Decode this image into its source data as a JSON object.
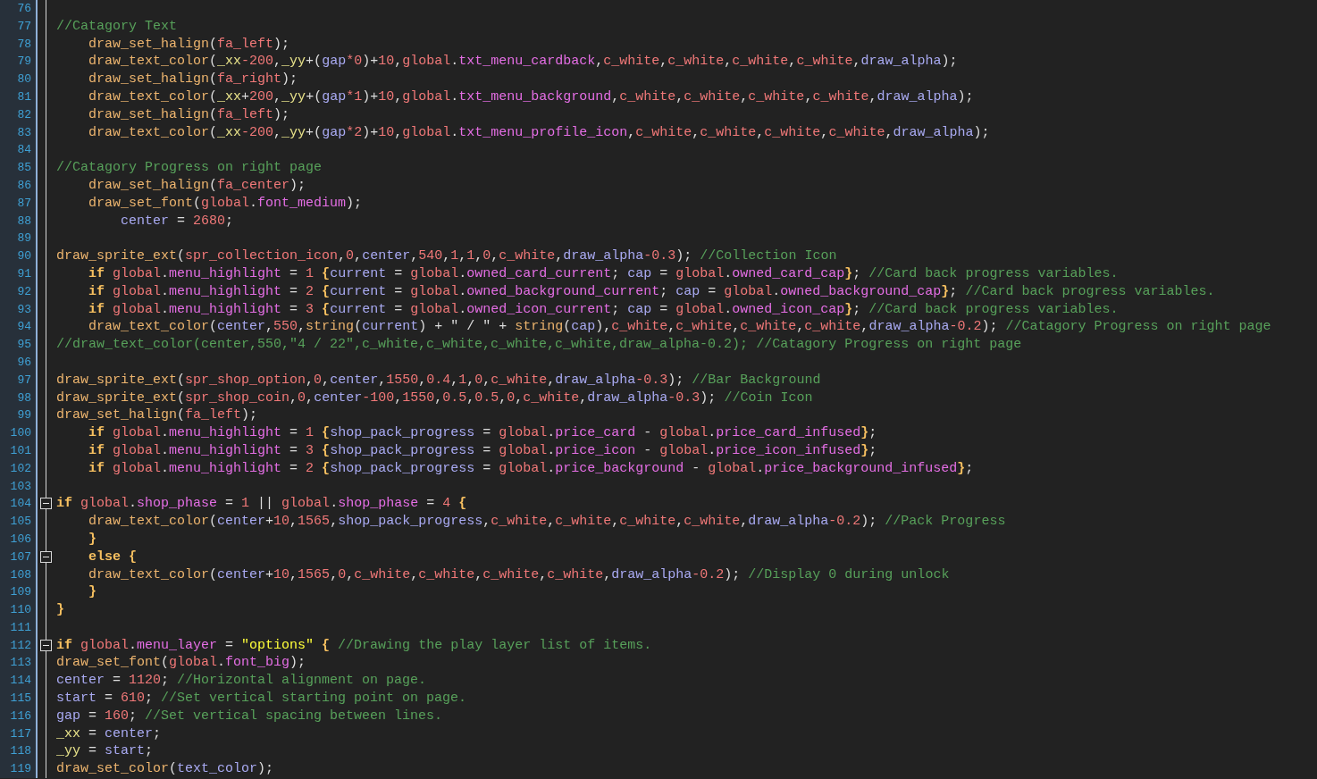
{
  "editor": {
    "lines": [
      {
        "number": "76"
      },
      {
        "number": "77",
        "tokens": [
          {
            "kind": "comment",
            "text": "//Catagory Text"
          }
        ]
      },
      {
        "number": "78",
        "tokens": [
          {
            "kind": "func",
            "text": "    draw_set_halign"
          },
          {
            "kind": "plain",
            "text": "("
          },
          {
            "kind": "const",
            "text": "fa_left"
          },
          {
            "kind": "plain",
            "text": ");"
          }
        ]
      },
      {
        "number": "79",
        "tokens": [
          {
            "kind": "func",
            "text": "    draw_text_color"
          },
          {
            "kind": "plain",
            "text": "("
          },
          {
            "kind": "local",
            "text": "_xx"
          },
          {
            "kind": "const",
            "text": "-200"
          },
          {
            "kind": "plain",
            "text": ","
          },
          {
            "kind": "local",
            "text": "_yy"
          },
          {
            "kind": "plain",
            "text": "+("
          },
          {
            "kind": "var",
            "text": "gap"
          },
          {
            "kind": "const",
            "text": "*0"
          },
          {
            "kind": "plain",
            "text": ")+"
          },
          {
            "kind": "const",
            "text": "10"
          },
          {
            "kind": "plain",
            "text": ","
          },
          {
            "kind": "const",
            "text": "global"
          },
          {
            "kind": "plain",
            "text": "."
          },
          {
            "kind": "field",
            "text": "txt_menu_cardback"
          },
          {
            "kind": "plain",
            "text": ","
          },
          {
            "kind": "const",
            "text": "c_white"
          },
          {
            "kind": "plain",
            "text": ","
          },
          {
            "kind": "const",
            "text": "c_white"
          },
          {
            "kind": "plain",
            "text": ","
          },
          {
            "kind": "const",
            "text": "c_white"
          },
          {
            "kind": "plain",
            "text": ","
          },
          {
            "kind": "const",
            "text": "c_white"
          },
          {
            "kind": "plain",
            "text": ","
          },
          {
            "kind": "var",
            "text": "draw_alpha"
          },
          {
            "kind": "plain",
            "text": ");"
          }
        ]
      },
      {
        "number": "80",
        "tokens": [
          {
            "kind": "func",
            "text": "    draw_set_halign"
          },
          {
            "kind": "plain",
            "text": "("
          },
          {
            "kind": "const",
            "text": "fa_right"
          },
          {
            "kind": "plain",
            "text": ");"
          }
        ]
      },
      {
        "number": "81",
        "tokens": [
          {
            "kind": "func",
            "text": "    draw_text_color"
          },
          {
            "kind": "plain",
            "text": "("
          },
          {
            "kind": "local",
            "text": "_xx"
          },
          {
            "kind": "plain",
            "text": "+"
          },
          {
            "kind": "const",
            "text": "200"
          },
          {
            "kind": "plain",
            "text": ","
          },
          {
            "kind": "local",
            "text": "_yy"
          },
          {
            "kind": "plain",
            "text": "+("
          },
          {
            "kind": "var",
            "text": "gap"
          },
          {
            "kind": "const",
            "text": "*1"
          },
          {
            "kind": "plain",
            "text": ")+"
          },
          {
            "kind": "const",
            "text": "10"
          },
          {
            "kind": "plain",
            "text": ","
          },
          {
            "kind": "const",
            "text": "global"
          },
          {
            "kind": "plain",
            "text": "."
          },
          {
            "kind": "field",
            "text": "txt_menu_background"
          },
          {
            "kind": "plain",
            "text": ","
          },
          {
            "kind": "const",
            "text": "c_white"
          },
          {
            "kind": "plain",
            "text": ","
          },
          {
            "kind": "const",
            "text": "c_white"
          },
          {
            "kind": "plain",
            "text": ","
          },
          {
            "kind": "const",
            "text": "c_white"
          },
          {
            "kind": "plain",
            "text": ","
          },
          {
            "kind": "const",
            "text": "c_white"
          },
          {
            "kind": "plain",
            "text": ","
          },
          {
            "kind": "var",
            "text": "draw_alpha"
          },
          {
            "kind": "plain",
            "text": ");"
          }
        ]
      },
      {
        "number": "82",
        "tokens": [
          {
            "kind": "func",
            "text": "    draw_set_halign"
          },
          {
            "kind": "plain",
            "text": "("
          },
          {
            "kind": "const",
            "text": "fa_left"
          },
          {
            "kind": "plain",
            "text": ");"
          }
        ]
      },
      {
        "number": "83",
        "tokens": [
          {
            "kind": "func",
            "text": "    draw_text_color"
          },
          {
            "kind": "plain",
            "text": "("
          },
          {
            "kind": "local",
            "text": "_xx"
          },
          {
            "kind": "const",
            "text": "-200"
          },
          {
            "kind": "plain",
            "text": ","
          },
          {
            "kind": "local",
            "text": "_yy"
          },
          {
            "kind": "plain",
            "text": "+("
          },
          {
            "kind": "var",
            "text": "gap"
          },
          {
            "kind": "const",
            "text": "*2"
          },
          {
            "kind": "plain",
            "text": ")+"
          },
          {
            "kind": "const",
            "text": "10"
          },
          {
            "kind": "plain",
            "text": ","
          },
          {
            "kind": "const",
            "text": "global"
          },
          {
            "kind": "plain",
            "text": "."
          },
          {
            "kind": "field",
            "text": "txt_menu_profile_icon"
          },
          {
            "kind": "plain",
            "text": ","
          },
          {
            "kind": "const",
            "text": "c_white"
          },
          {
            "kind": "plain",
            "text": ","
          },
          {
            "kind": "const",
            "text": "c_white"
          },
          {
            "kind": "plain",
            "text": ","
          },
          {
            "kind": "const",
            "text": "c_white"
          },
          {
            "kind": "plain",
            "text": ","
          },
          {
            "kind": "const",
            "text": "c_white"
          },
          {
            "kind": "plain",
            "text": ","
          },
          {
            "kind": "var",
            "text": "draw_alpha"
          },
          {
            "kind": "plain",
            "text": ");"
          }
        ]
      },
      {
        "number": "84"
      },
      {
        "number": "85",
        "tokens": [
          {
            "kind": "comment",
            "text": "//Catagory Progress on right page"
          }
        ]
      },
      {
        "number": "86",
        "tokens": [
          {
            "kind": "func",
            "text": "    draw_set_halign"
          },
          {
            "kind": "plain",
            "text": "("
          },
          {
            "kind": "const",
            "text": "fa_center"
          },
          {
            "kind": "plain",
            "text": ");"
          }
        ]
      },
      {
        "number": "87",
        "tokens": [
          {
            "kind": "func",
            "text": "    draw_set_font"
          },
          {
            "kind": "plain",
            "text": "("
          },
          {
            "kind": "const",
            "text": "global"
          },
          {
            "kind": "plain",
            "text": "."
          },
          {
            "kind": "field",
            "text": "font_medium"
          },
          {
            "kind": "plain",
            "text": ");"
          }
        ]
      },
      {
        "number": "88",
        "tokens": [
          {
            "kind": "var",
            "text": "        center"
          },
          {
            "kind": "plain",
            "text": " = "
          },
          {
            "kind": "const",
            "text": "2680"
          },
          {
            "kind": "plain",
            "text": ";"
          }
        ]
      },
      {
        "number": "89"
      },
      {
        "number": "90",
        "tokens": [
          {
            "kind": "func",
            "text": "draw_sprite_ext"
          },
          {
            "kind": "plain",
            "text": "("
          },
          {
            "kind": "const",
            "text": "spr_collection_icon"
          },
          {
            "kind": "plain",
            "text": ","
          },
          {
            "kind": "const",
            "text": "0"
          },
          {
            "kind": "plain",
            "text": ","
          },
          {
            "kind": "var",
            "text": "center"
          },
          {
            "kind": "plain",
            "text": ","
          },
          {
            "kind": "const",
            "text": "540"
          },
          {
            "kind": "plain",
            "text": ","
          },
          {
            "kind": "const",
            "text": "1"
          },
          {
            "kind": "plain",
            "text": ","
          },
          {
            "kind": "const",
            "text": "1"
          },
          {
            "kind": "plain",
            "text": ","
          },
          {
            "kind": "const",
            "text": "0"
          },
          {
            "kind": "plain",
            "text": ","
          },
          {
            "kind": "const",
            "text": "c_white"
          },
          {
            "kind": "plain",
            "text": ","
          },
          {
            "kind": "var",
            "text": "draw_alpha"
          },
          {
            "kind": "const",
            "text": "-0.3"
          },
          {
            "kind": "plain",
            "text": "); "
          },
          {
            "kind": "comment",
            "text": "//Collection Icon"
          }
        ]
      },
      {
        "number": "91",
        "tokens": [
          {
            "kind": "keyword",
            "text": "    if "
          },
          {
            "kind": "const",
            "text": "global"
          },
          {
            "kind": "plain",
            "text": "."
          },
          {
            "kind": "field",
            "text": "menu_highlight"
          },
          {
            "kind": "plain",
            "text": " = "
          },
          {
            "kind": "const",
            "text": "1 "
          },
          {
            "kind": "keyword",
            "text": "{"
          },
          {
            "kind": "var",
            "text": "current"
          },
          {
            "kind": "plain",
            "text": " = "
          },
          {
            "kind": "const",
            "text": "global"
          },
          {
            "kind": "plain",
            "text": "."
          },
          {
            "kind": "field",
            "text": "owned_card_current"
          },
          {
            "kind": "plain",
            "text": "; "
          },
          {
            "kind": "var",
            "text": "cap"
          },
          {
            "kind": "plain",
            "text": " = "
          },
          {
            "kind": "const",
            "text": "global"
          },
          {
            "kind": "plain",
            "text": "."
          },
          {
            "kind": "field",
            "text": "owned_card_cap"
          },
          {
            "kind": "keyword",
            "text": "}"
          },
          {
            "kind": "plain",
            "text": "; "
          },
          {
            "kind": "comment",
            "text": "//Card back progress variables."
          }
        ]
      },
      {
        "number": "92",
        "tokens": [
          {
            "kind": "keyword",
            "text": "    if "
          },
          {
            "kind": "const",
            "text": "global"
          },
          {
            "kind": "plain",
            "text": "."
          },
          {
            "kind": "field",
            "text": "menu_highlight"
          },
          {
            "kind": "plain",
            "text": " = "
          },
          {
            "kind": "const",
            "text": "2 "
          },
          {
            "kind": "keyword",
            "text": "{"
          },
          {
            "kind": "var",
            "text": "current"
          },
          {
            "kind": "plain",
            "text": " = "
          },
          {
            "kind": "const",
            "text": "global"
          },
          {
            "kind": "plain",
            "text": "."
          },
          {
            "kind": "field",
            "text": "owned_background_current"
          },
          {
            "kind": "plain",
            "text": "; "
          },
          {
            "kind": "var",
            "text": "cap"
          },
          {
            "kind": "plain",
            "text": " = "
          },
          {
            "kind": "const",
            "text": "global"
          },
          {
            "kind": "plain",
            "text": "."
          },
          {
            "kind": "field",
            "text": "owned_background_cap"
          },
          {
            "kind": "keyword",
            "text": "}"
          },
          {
            "kind": "plain",
            "text": "; "
          },
          {
            "kind": "comment",
            "text": "//Card back progress variables."
          }
        ]
      },
      {
        "number": "93",
        "tokens": [
          {
            "kind": "keyword",
            "text": "    if "
          },
          {
            "kind": "const",
            "text": "global"
          },
          {
            "kind": "plain",
            "text": "."
          },
          {
            "kind": "field",
            "text": "menu_highlight"
          },
          {
            "kind": "plain",
            "text": " = "
          },
          {
            "kind": "const",
            "text": "3 "
          },
          {
            "kind": "keyword",
            "text": "{"
          },
          {
            "kind": "var",
            "text": "current"
          },
          {
            "kind": "plain",
            "text": " = "
          },
          {
            "kind": "const",
            "text": "global"
          },
          {
            "kind": "plain",
            "text": "."
          },
          {
            "kind": "field",
            "text": "owned_icon_current"
          },
          {
            "kind": "plain",
            "text": "; "
          },
          {
            "kind": "var",
            "text": "cap"
          },
          {
            "kind": "plain",
            "text": " = "
          },
          {
            "kind": "const",
            "text": "global"
          },
          {
            "kind": "plain",
            "text": "."
          },
          {
            "kind": "field",
            "text": "owned_icon_cap"
          },
          {
            "kind": "keyword",
            "text": "}"
          },
          {
            "kind": "plain",
            "text": "; "
          },
          {
            "kind": "comment",
            "text": "//Card back progress variables."
          }
        ]
      },
      {
        "number": "94",
        "tokens": [
          {
            "kind": "func",
            "text": "    draw_text_color"
          },
          {
            "kind": "plain",
            "text": "("
          },
          {
            "kind": "var",
            "text": "center"
          },
          {
            "kind": "plain",
            "text": ","
          },
          {
            "kind": "const",
            "text": "550"
          },
          {
            "kind": "plain",
            "text": ","
          },
          {
            "kind": "func",
            "text": "string"
          },
          {
            "kind": "plain",
            "text": "("
          },
          {
            "kind": "var",
            "text": "current"
          },
          {
            "kind": "plain",
            "text": ") + \" / \" + "
          },
          {
            "kind": "func",
            "text": "string"
          },
          {
            "kind": "plain",
            "text": "("
          },
          {
            "kind": "var",
            "text": "cap"
          },
          {
            "kind": "plain",
            "text": "),"
          },
          {
            "kind": "const",
            "text": "c_white"
          },
          {
            "kind": "plain",
            "text": ","
          },
          {
            "kind": "const",
            "text": "c_white"
          },
          {
            "kind": "plain",
            "text": ","
          },
          {
            "kind": "const",
            "text": "c_white"
          },
          {
            "kind": "plain",
            "text": ","
          },
          {
            "kind": "const",
            "text": "c_white"
          },
          {
            "kind": "plain",
            "text": ","
          },
          {
            "kind": "var",
            "text": "draw_alpha"
          },
          {
            "kind": "const",
            "text": "-0.2"
          },
          {
            "kind": "plain",
            "text": "); "
          },
          {
            "kind": "comment",
            "text": "//Catagory Progress on right page"
          }
        ]
      },
      {
        "number": "95",
        "tokens": [
          {
            "kind": "comment",
            "text": "//draw_text_color(center,550,\"4 / 22\",c_white,c_white,c_white,c_white,draw_alpha-0.2); //Catagory Progress on right page"
          }
        ]
      },
      {
        "number": "96"
      },
      {
        "number": "97",
        "tokens": [
          {
            "kind": "func",
            "text": "draw_sprite_ext"
          },
          {
            "kind": "plain",
            "text": "("
          },
          {
            "kind": "const",
            "text": "spr_shop_option"
          },
          {
            "kind": "plain",
            "text": ","
          },
          {
            "kind": "const",
            "text": "0"
          },
          {
            "kind": "plain",
            "text": ","
          },
          {
            "kind": "var",
            "text": "center"
          },
          {
            "kind": "plain",
            "text": ","
          },
          {
            "kind": "const",
            "text": "1550"
          },
          {
            "kind": "plain",
            "text": ","
          },
          {
            "kind": "const",
            "text": "0.4"
          },
          {
            "kind": "plain",
            "text": ","
          },
          {
            "kind": "const",
            "text": "1"
          },
          {
            "kind": "plain",
            "text": ","
          },
          {
            "kind": "const",
            "text": "0"
          },
          {
            "kind": "plain",
            "text": ","
          },
          {
            "kind": "const",
            "text": "c_white"
          },
          {
            "kind": "plain",
            "text": ","
          },
          {
            "kind": "var",
            "text": "draw_alpha"
          },
          {
            "kind": "const",
            "text": "-0.3"
          },
          {
            "kind": "plain",
            "text": "); "
          },
          {
            "kind": "comment",
            "text": "//Bar Background"
          }
        ]
      },
      {
        "number": "98",
        "tokens": [
          {
            "kind": "func",
            "text": "draw_sprite_ext"
          },
          {
            "kind": "plain",
            "text": "("
          },
          {
            "kind": "const",
            "text": "spr_shop_coin"
          },
          {
            "kind": "plain",
            "text": ","
          },
          {
            "kind": "const",
            "text": "0"
          },
          {
            "kind": "plain",
            "text": ","
          },
          {
            "kind": "var",
            "text": "center"
          },
          {
            "kind": "const",
            "text": "-100"
          },
          {
            "kind": "plain",
            "text": ","
          },
          {
            "kind": "const",
            "text": "1550"
          },
          {
            "kind": "plain",
            "text": ","
          },
          {
            "kind": "const",
            "text": "0.5"
          },
          {
            "kind": "plain",
            "text": ","
          },
          {
            "kind": "const",
            "text": "0.5"
          },
          {
            "kind": "plain",
            "text": ","
          },
          {
            "kind": "const",
            "text": "0"
          },
          {
            "kind": "plain",
            "text": ","
          },
          {
            "kind": "const",
            "text": "c_white"
          },
          {
            "kind": "plain",
            "text": ","
          },
          {
            "kind": "var",
            "text": "draw_alpha"
          },
          {
            "kind": "const",
            "text": "-0.3"
          },
          {
            "kind": "plain",
            "text": "); "
          },
          {
            "kind": "comment",
            "text": "//Coin Icon"
          }
        ]
      },
      {
        "number": "99",
        "tokens": [
          {
            "kind": "func",
            "text": "draw_set_halign"
          },
          {
            "kind": "plain",
            "text": "("
          },
          {
            "kind": "const",
            "text": "fa_left"
          },
          {
            "kind": "plain",
            "text": ");"
          }
        ]
      },
      {
        "number": "100",
        "tokens": [
          {
            "kind": "keyword",
            "text": "    if "
          },
          {
            "kind": "const",
            "text": "global"
          },
          {
            "kind": "plain",
            "text": "."
          },
          {
            "kind": "field",
            "text": "menu_highlight"
          },
          {
            "kind": "plain",
            "text": " = "
          },
          {
            "kind": "const",
            "text": "1 "
          },
          {
            "kind": "keyword",
            "text": "{"
          },
          {
            "kind": "var",
            "text": "shop_pack_progress"
          },
          {
            "kind": "plain",
            "text": " = "
          },
          {
            "kind": "const",
            "text": "global"
          },
          {
            "kind": "plain",
            "text": "."
          },
          {
            "kind": "field",
            "text": "price_card"
          },
          {
            "kind": "plain",
            "text": " - "
          },
          {
            "kind": "const",
            "text": "global"
          },
          {
            "kind": "plain",
            "text": "."
          },
          {
            "kind": "field",
            "text": "price_card_infused"
          },
          {
            "kind": "keyword",
            "text": "}"
          },
          {
            "kind": "plain",
            "text": ";"
          }
        ]
      },
      {
        "number": "101",
        "tokens": [
          {
            "kind": "keyword",
            "text": "    if "
          },
          {
            "kind": "const",
            "text": "global"
          },
          {
            "kind": "plain",
            "text": "."
          },
          {
            "kind": "field",
            "text": "menu_highlight"
          },
          {
            "kind": "plain",
            "text": " = "
          },
          {
            "kind": "const",
            "text": "3 "
          },
          {
            "kind": "keyword",
            "text": "{"
          },
          {
            "kind": "var",
            "text": "shop_pack_progress"
          },
          {
            "kind": "plain",
            "text": " = "
          },
          {
            "kind": "const",
            "text": "global"
          },
          {
            "kind": "plain",
            "text": "."
          },
          {
            "kind": "field",
            "text": "price_icon"
          },
          {
            "kind": "plain",
            "text": " - "
          },
          {
            "kind": "const",
            "text": "global"
          },
          {
            "kind": "plain",
            "text": "."
          },
          {
            "kind": "field",
            "text": "price_icon_infused"
          },
          {
            "kind": "keyword",
            "text": "}"
          },
          {
            "kind": "plain",
            "text": ";"
          }
        ]
      },
      {
        "number": "102",
        "tokens": [
          {
            "kind": "keyword",
            "text": "    if "
          },
          {
            "kind": "const",
            "text": "global"
          },
          {
            "kind": "plain",
            "text": "."
          },
          {
            "kind": "field",
            "text": "menu_highlight"
          },
          {
            "kind": "plain",
            "text": " = "
          },
          {
            "kind": "const",
            "text": "2 "
          },
          {
            "kind": "keyword",
            "text": "{"
          },
          {
            "kind": "var",
            "text": "shop_pack_progress"
          },
          {
            "kind": "plain",
            "text": " = "
          },
          {
            "kind": "const",
            "text": "global"
          },
          {
            "kind": "plain",
            "text": "."
          },
          {
            "kind": "field",
            "text": "price_background"
          },
          {
            "kind": "plain",
            "text": " - "
          },
          {
            "kind": "const",
            "text": "global"
          },
          {
            "kind": "plain",
            "text": "."
          },
          {
            "kind": "field",
            "text": "price_background_infused"
          },
          {
            "kind": "keyword",
            "text": "}"
          },
          {
            "kind": "plain",
            "text": ";"
          }
        ]
      },
      {
        "number": "103"
      },
      {
        "number": "104",
        "fold": {
          "expanded": true
        },
        "tokens": [
          {
            "kind": "keyword",
            "text": "if "
          },
          {
            "kind": "const",
            "text": "global"
          },
          {
            "kind": "plain",
            "text": "."
          },
          {
            "kind": "field",
            "text": "shop_phase"
          },
          {
            "kind": "plain",
            "text": " = "
          },
          {
            "kind": "const",
            "text": "1"
          },
          {
            "kind": "plain",
            "text": " || "
          },
          {
            "kind": "const",
            "text": "global"
          },
          {
            "kind": "plain",
            "text": "."
          },
          {
            "kind": "field",
            "text": "shop_phase"
          },
          {
            "kind": "plain",
            "text": " = "
          },
          {
            "kind": "const",
            "text": "4 "
          },
          {
            "kind": "keyword",
            "text": "{"
          }
        ]
      },
      {
        "number": "105",
        "tokens": [
          {
            "kind": "func",
            "text": "    draw_text_color"
          },
          {
            "kind": "plain",
            "text": "("
          },
          {
            "kind": "var",
            "text": "center"
          },
          {
            "kind": "plain",
            "text": "+"
          },
          {
            "kind": "const",
            "text": "10"
          },
          {
            "kind": "plain",
            "text": ","
          },
          {
            "kind": "const",
            "text": "1565"
          },
          {
            "kind": "plain",
            "text": ","
          },
          {
            "kind": "var",
            "text": "shop_pack_progress"
          },
          {
            "kind": "plain",
            "text": ","
          },
          {
            "kind": "const",
            "text": "c_white"
          },
          {
            "kind": "plain",
            "text": ","
          },
          {
            "kind": "const",
            "text": "c_white"
          },
          {
            "kind": "plain",
            "text": ","
          },
          {
            "kind": "const",
            "text": "c_white"
          },
          {
            "kind": "plain",
            "text": ","
          },
          {
            "kind": "const",
            "text": "c_white"
          },
          {
            "kind": "plain",
            "text": ","
          },
          {
            "kind": "var",
            "text": "draw_alpha"
          },
          {
            "kind": "const",
            "text": "-0.2"
          },
          {
            "kind": "plain",
            "text": "); "
          },
          {
            "kind": "comment",
            "text": "//Pack Progress"
          }
        ]
      },
      {
        "number": "106",
        "tokens": [
          {
            "kind": "keyword",
            "text": "    }"
          }
        ]
      },
      {
        "number": "107",
        "fold": {
          "expanded": true
        },
        "tokens": [
          {
            "kind": "keyword",
            "text": "    else {"
          }
        ]
      },
      {
        "number": "108",
        "tokens": [
          {
            "kind": "func",
            "text": "    draw_text_color"
          },
          {
            "kind": "plain",
            "text": "("
          },
          {
            "kind": "var",
            "text": "center"
          },
          {
            "kind": "plain",
            "text": "+"
          },
          {
            "kind": "const",
            "text": "10"
          },
          {
            "kind": "plain",
            "text": ","
          },
          {
            "kind": "const",
            "text": "1565"
          },
          {
            "kind": "plain",
            "text": ","
          },
          {
            "kind": "const",
            "text": "0"
          },
          {
            "kind": "plain",
            "text": ","
          },
          {
            "kind": "const",
            "text": "c_white"
          },
          {
            "kind": "plain",
            "text": ","
          },
          {
            "kind": "const",
            "text": "c_white"
          },
          {
            "kind": "plain",
            "text": ","
          },
          {
            "kind": "const",
            "text": "c_white"
          },
          {
            "kind": "plain",
            "text": ","
          },
          {
            "kind": "const",
            "text": "c_white"
          },
          {
            "kind": "plain",
            "text": ","
          },
          {
            "kind": "var",
            "text": "draw_alpha"
          },
          {
            "kind": "const",
            "text": "-0.2"
          },
          {
            "kind": "plain",
            "text": "); "
          },
          {
            "kind": "comment",
            "text": "//Display 0 during unlock"
          }
        ]
      },
      {
        "number": "109",
        "tokens": [
          {
            "kind": "keyword",
            "text": "    }"
          }
        ]
      },
      {
        "number": "110",
        "tokens": [
          {
            "kind": "keyword",
            "text": "}"
          }
        ]
      },
      {
        "number": "111"
      },
      {
        "number": "112",
        "fold": {
          "expanded": true
        },
        "tokens": [
          {
            "kind": "keyword",
            "text": "if "
          },
          {
            "kind": "const",
            "text": "global"
          },
          {
            "kind": "plain",
            "text": "."
          },
          {
            "kind": "field",
            "text": "menu_layer"
          },
          {
            "kind": "plain",
            "text": " = "
          },
          {
            "kind": "string",
            "text": "\"options\""
          },
          {
            "kind": "keyword",
            "text": " {"
          },
          {
            "kind": "comment",
            "text": " //Drawing the play layer list of items."
          }
        ]
      },
      {
        "number": "113",
        "tokens": [
          {
            "kind": "func",
            "text": "draw_set_font"
          },
          {
            "kind": "plain",
            "text": "("
          },
          {
            "kind": "const",
            "text": "global"
          },
          {
            "kind": "plain",
            "text": "."
          },
          {
            "kind": "field",
            "text": "font_big"
          },
          {
            "kind": "plain",
            "text": ");"
          }
        ]
      },
      {
        "number": "114",
        "tokens": [
          {
            "kind": "var",
            "text": "center"
          },
          {
            "kind": "plain",
            "text": " = "
          },
          {
            "kind": "const",
            "text": "1120"
          },
          {
            "kind": "plain",
            "text": "; "
          },
          {
            "kind": "comment",
            "text": "//Horizontal alignment on page."
          }
        ]
      },
      {
        "number": "115",
        "tokens": [
          {
            "kind": "var",
            "text": "start"
          },
          {
            "kind": "plain",
            "text": " = "
          },
          {
            "kind": "const",
            "text": "610"
          },
          {
            "kind": "plain",
            "text": "; "
          },
          {
            "kind": "comment",
            "text": "//Set vertical starting point on page."
          }
        ]
      },
      {
        "number": "116",
        "tokens": [
          {
            "kind": "var",
            "text": "gap"
          },
          {
            "kind": "plain",
            "text": " = "
          },
          {
            "kind": "const",
            "text": "160"
          },
          {
            "kind": "plain",
            "text": "; "
          },
          {
            "kind": "comment",
            "text": "//Set vertical spacing between lines."
          }
        ]
      },
      {
        "number": "117",
        "tokens": [
          {
            "kind": "local",
            "text": "_xx"
          },
          {
            "kind": "plain",
            "text": " = "
          },
          {
            "kind": "var",
            "text": "center"
          },
          {
            "kind": "plain",
            "text": ";"
          }
        ]
      },
      {
        "number": "118",
        "tokens": [
          {
            "kind": "local",
            "text": "_yy"
          },
          {
            "kind": "plain",
            "text": " = "
          },
          {
            "kind": "var",
            "text": "start"
          },
          {
            "kind": "plain",
            "text": ";"
          }
        ]
      },
      {
        "number": "119",
        "tokens": [
          {
            "kind": "func",
            "text": "draw_set_color"
          },
          {
            "kind": "plain",
            "text": "("
          },
          {
            "kind": "var",
            "text": "text_color"
          },
          {
            "kind": "plain",
            "text": ");"
          }
        ]
      }
    ]
  }
}
